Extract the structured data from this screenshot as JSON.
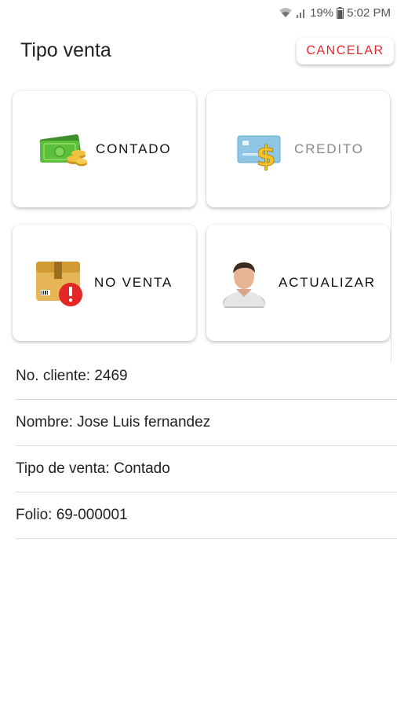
{
  "status_bar": {
    "battery": "19%",
    "time": "5:02 PM",
    "icons": [
      "wifi-icon",
      "signal-icon",
      "battery-icon"
    ]
  },
  "header": {
    "title": "Tipo venta",
    "cancel_label": "CANCELAR"
  },
  "tiles": {
    "contado": {
      "label": "CONTADO",
      "icon": "cash-icon"
    },
    "credito": {
      "label": "CREDITO",
      "icon": "credit-card-icon"
    },
    "no_venta": {
      "label": "NO VENTA",
      "icon": "package-alert-icon"
    },
    "actualizar": {
      "label": "ACTUALIZAR",
      "icon": "user-icon"
    }
  },
  "info": {
    "cliente": "No. cliente: 2469",
    "nombre": "Nombre: Jose Luis fernandez",
    "tipo_venta": "Tipo de venta: Contado",
    "folio": "Folio: 69-000001"
  },
  "colors": {
    "accent": "#e8252b",
    "disabled_text": "#888888"
  }
}
